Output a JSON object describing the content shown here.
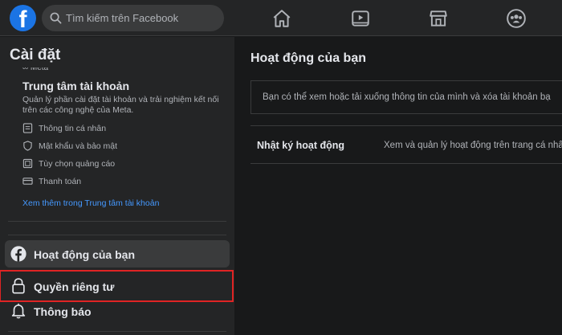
{
  "topbar": {
    "logo_letter": "f",
    "search_placeholder": "Tìm kiếm trên Facebook",
    "icons": [
      "home-icon",
      "video-icon",
      "marketplace-icon",
      "groups-icon"
    ]
  },
  "sidebar": {
    "title": "Cài đặt",
    "meta_label": "∞ Meta",
    "accounts_center": {
      "title": "Trung tâm tài khoản",
      "description": "Quản lý phần cài đặt tài khoản và trải nghiệm kết nối trên các công nghệ của Meta.",
      "items": [
        {
          "label": "Thông tin cá nhân",
          "icon": "personal-info-icon"
        },
        {
          "label": "Mật khẩu và bảo mật",
          "icon": "shield-icon"
        },
        {
          "label": "Tùy chọn quảng cáo",
          "icon": "ad-preferences-icon"
        },
        {
          "label": "Thanh toán",
          "icon": "card-icon"
        }
      ],
      "see_more": "Xem thêm trong Trung tâm tài khoản"
    },
    "menu": [
      {
        "label": "Hoạt động của bạn",
        "icon": "facebook-icon",
        "state": "active"
      },
      {
        "label": "Quyền riêng tư",
        "icon": "lock-icon",
        "state": "highlighted"
      },
      {
        "label": "Thông báo",
        "icon": "bell-icon",
        "state": "normal"
      }
    ]
  },
  "main": {
    "title": "Hoạt động của bạn",
    "info": "Bạn có thể xem hoặc tải xuống thông tin của mình và xóa tài khoản bạ",
    "rows": [
      {
        "label": "Nhật ký hoạt động",
        "description": "Xem và quản lý hoạt động trên trang cá nhân"
      }
    ]
  },
  "colors": {
    "accent": "#1b74e4",
    "link": "#4599ff",
    "highlight_border": "#e02424",
    "panel": "#242526",
    "background": "#18191a"
  }
}
